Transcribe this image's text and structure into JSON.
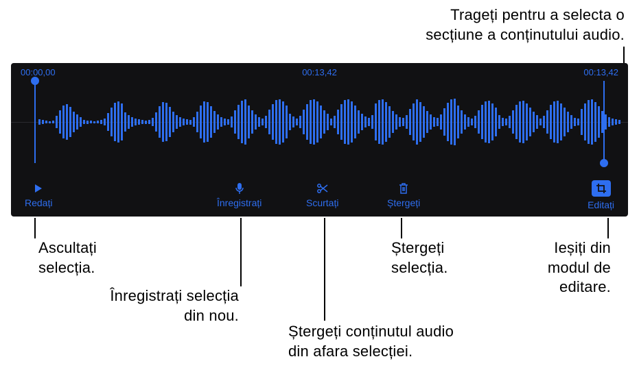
{
  "callouts": {
    "drag_select": "Trageți pentru a selecta o\nsecțiune a conținutului audio.",
    "listen": "Ascultați\nselecția.",
    "rerecord": "Înregistrați selecția\ndin nou.",
    "delete_selection": "Ștergeți\nselecția.",
    "exit_edit": "Ieșiți din\nmodul de\neditare.",
    "trim_outside": "Ștergeți conținutul audio\ndin afara selecției."
  },
  "time": {
    "start": "00:00,00",
    "current": "00:13,42",
    "end": "00:13,42"
  },
  "toolbar": {
    "play": "Redați",
    "record": "Înregistrați",
    "trim": "Scurtați",
    "delete": "Ștergeți",
    "edit": "Editați"
  }
}
